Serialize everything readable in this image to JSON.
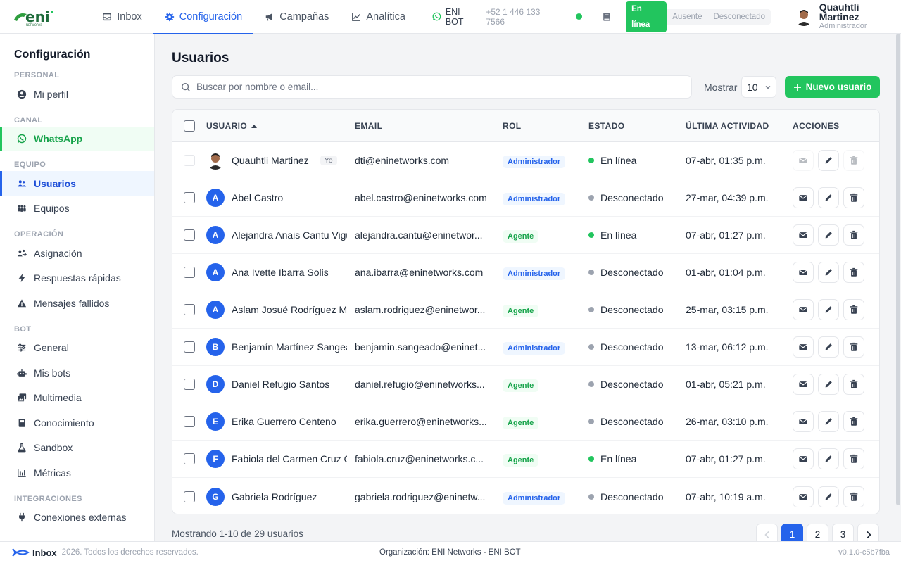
{
  "app": {
    "title": "Configuración"
  },
  "topbar": {
    "nav": [
      {
        "label": "Inbox",
        "icon": "inbox-icon",
        "active": false
      },
      {
        "label": "Configuración",
        "icon": "gear-icon",
        "active": true
      },
      {
        "label": "Campañas",
        "icon": "megaphone-icon",
        "active": false
      },
      {
        "label": "Analítica",
        "icon": "chart-icon",
        "active": false
      }
    ],
    "bot_name": "ENI BOT",
    "bot_phone": "+52 1 446 133 7566",
    "status_options": [
      "En línea",
      "Ausente",
      "Desconectado"
    ],
    "status_selected": "En línea",
    "user_name": "Quauhtli Martinez",
    "user_role": "Administrador"
  },
  "sidebar": {
    "title": "Configuración",
    "sections": [
      {
        "label": "PERSONAL",
        "items": [
          {
            "label": "Mi perfil",
            "icon": "user-circle-icon"
          }
        ]
      },
      {
        "label": "CANAL",
        "items": [
          {
            "label": "WhatsApp",
            "icon": "whatsapp-icon",
            "style": "wa"
          }
        ]
      },
      {
        "label": "EQUIPO",
        "items": [
          {
            "label": "Usuarios",
            "icon": "users-icon",
            "style": "active"
          },
          {
            "label": "Equipos",
            "icon": "team-icon"
          }
        ]
      },
      {
        "label": "OPERACIÓN",
        "items": [
          {
            "label": "Asignación",
            "icon": "assign-icon"
          },
          {
            "label": "Respuestas rápidas",
            "icon": "bolt-icon"
          },
          {
            "label": "Mensajes fallidos",
            "icon": "warning-icon"
          }
        ]
      },
      {
        "label": "BOT",
        "items": [
          {
            "label": "General",
            "icon": "sliders-icon"
          },
          {
            "label": "Mis bots",
            "icon": "robot-icon"
          },
          {
            "label": "Multimedia",
            "icon": "images-icon"
          },
          {
            "label": "Conocimiento",
            "icon": "book-icon"
          },
          {
            "label": "Sandbox",
            "icon": "flask-icon"
          },
          {
            "label": "Métricas",
            "icon": "metrics-icon"
          }
        ]
      },
      {
        "label": "INTEGRACIONES",
        "items": [
          {
            "label": "Conexiones externas",
            "icon": "plug-icon"
          }
        ]
      }
    ]
  },
  "main": {
    "title": "Usuarios",
    "search_placeholder": "Buscar por nombre o email...",
    "show_label": "Mostrar",
    "show_value": "10",
    "new_button": "Nuevo usuario",
    "columns": [
      "USUARIO",
      "EMAIL",
      "ROL",
      "ESTADO",
      "ÚLTIMA ACTIVIDAD",
      "ACCIONES"
    ],
    "rows": [
      {
        "initial": "",
        "photo": true,
        "name": "Quauhtli Martinez",
        "you": "Yo",
        "email": "dti@eninetworks.com",
        "role": "Administrador",
        "role_type": "admin",
        "status": "En línea",
        "online": true,
        "last": "07-abr, 01:35 p.m.",
        "self": true
      },
      {
        "initial": "A",
        "name": "Abel Castro",
        "email": "abel.castro@eninetworks.com",
        "role": "Administrador",
        "role_type": "admin",
        "status": "Desconectado",
        "online": false,
        "last": "27-mar, 04:39 p.m."
      },
      {
        "initial": "A",
        "name": "Alejandra Anais Cantu Vigu",
        "email": "alejandra.cantu@eninetwor...",
        "role": "Agente",
        "role_type": "agent",
        "status": "En línea",
        "online": true,
        "last": "07-abr, 01:27 p.m."
      },
      {
        "initial": "A",
        "name": "Ana Ivette Ibarra Solis",
        "email": "ana.ibarra@eninetworks.com",
        "role": "Administrador",
        "role_type": "admin",
        "status": "Desconectado",
        "online": false,
        "last": "01-abr, 01:04 p.m."
      },
      {
        "initial": "A",
        "name": "Aslam Josué Rodríguez Me",
        "email": "aslam.rodriguez@eninetwor...",
        "role": "Agente",
        "role_type": "agent",
        "status": "Desconectado",
        "online": false,
        "last": "25-mar, 03:15 p.m."
      },
      {
        "initial": "B",
        "name": "Benjamín Martínez Sangea",
        "email": "benjamin.sangeado@eninet...",
        "role": "Administrador",
        "role_type": "admin",
        "status": "Desconectado",
        "online": false,
        "last": "13-mar, 06:12 p.m."
      },
      {
        "initial": "D",
        "name": "Daniel Refugio Santos",
        "email": "daniel.refugio@eninetworks...",
        "role": "Agente",
        "role_type": "agent",
        "status": "Desconectado",
        "online": false,
        "last": "01-abr, 05:21 p.m."
      },
      {
        "initial": "E",
        "name": "Erika Guerrero Centeno",
        "email": "erika.guerrero@eninetworks...",
        "role": "Agente",
        "role_type": "agent",
        "status": "Desconectado",
        "online": false,
        "last": "26-mar, 03:10 p.m."
      },
      {
        "initial": "F",
        "name": "Fabiola del Carmen Cruz G",
        "email": "fabiola.cruz@eninetworks.c...",
        "role": "Agente",
        "role_type": "agent",
        "status": "En línea",
        "online": true,
        "last": "07-abr, 01:27 p.m."
      },
      {
        "initial": "G",
        "name": "Gabriela Rodríguez",
        "email": "gabriela.rodriguez@eninetw...",
        "role": "Administrador",
        "role_type": "admin",
        "status": "Desconectado",
        "online": false,
        "last": "07-abr, 10:19 a.m."
      }
    ],
    "showing": "Mostrando 1-10 de 29 usuarios",
    "pages": [
      "1",
      "2",
      "3"
    ],
    "current_page": "1"
  },
  "footer": {
    "brand": "Inbox",
    "copyright": "2026. Todos los derechos reservados.",
    "org": "Organización: ENI Networks - ENI BOT",
    "version": "v0.1.0-c5b7fba"
  },
  "colors": {
    "accent": "#2563eb",
    "success": "#22c55e"
  }
}
